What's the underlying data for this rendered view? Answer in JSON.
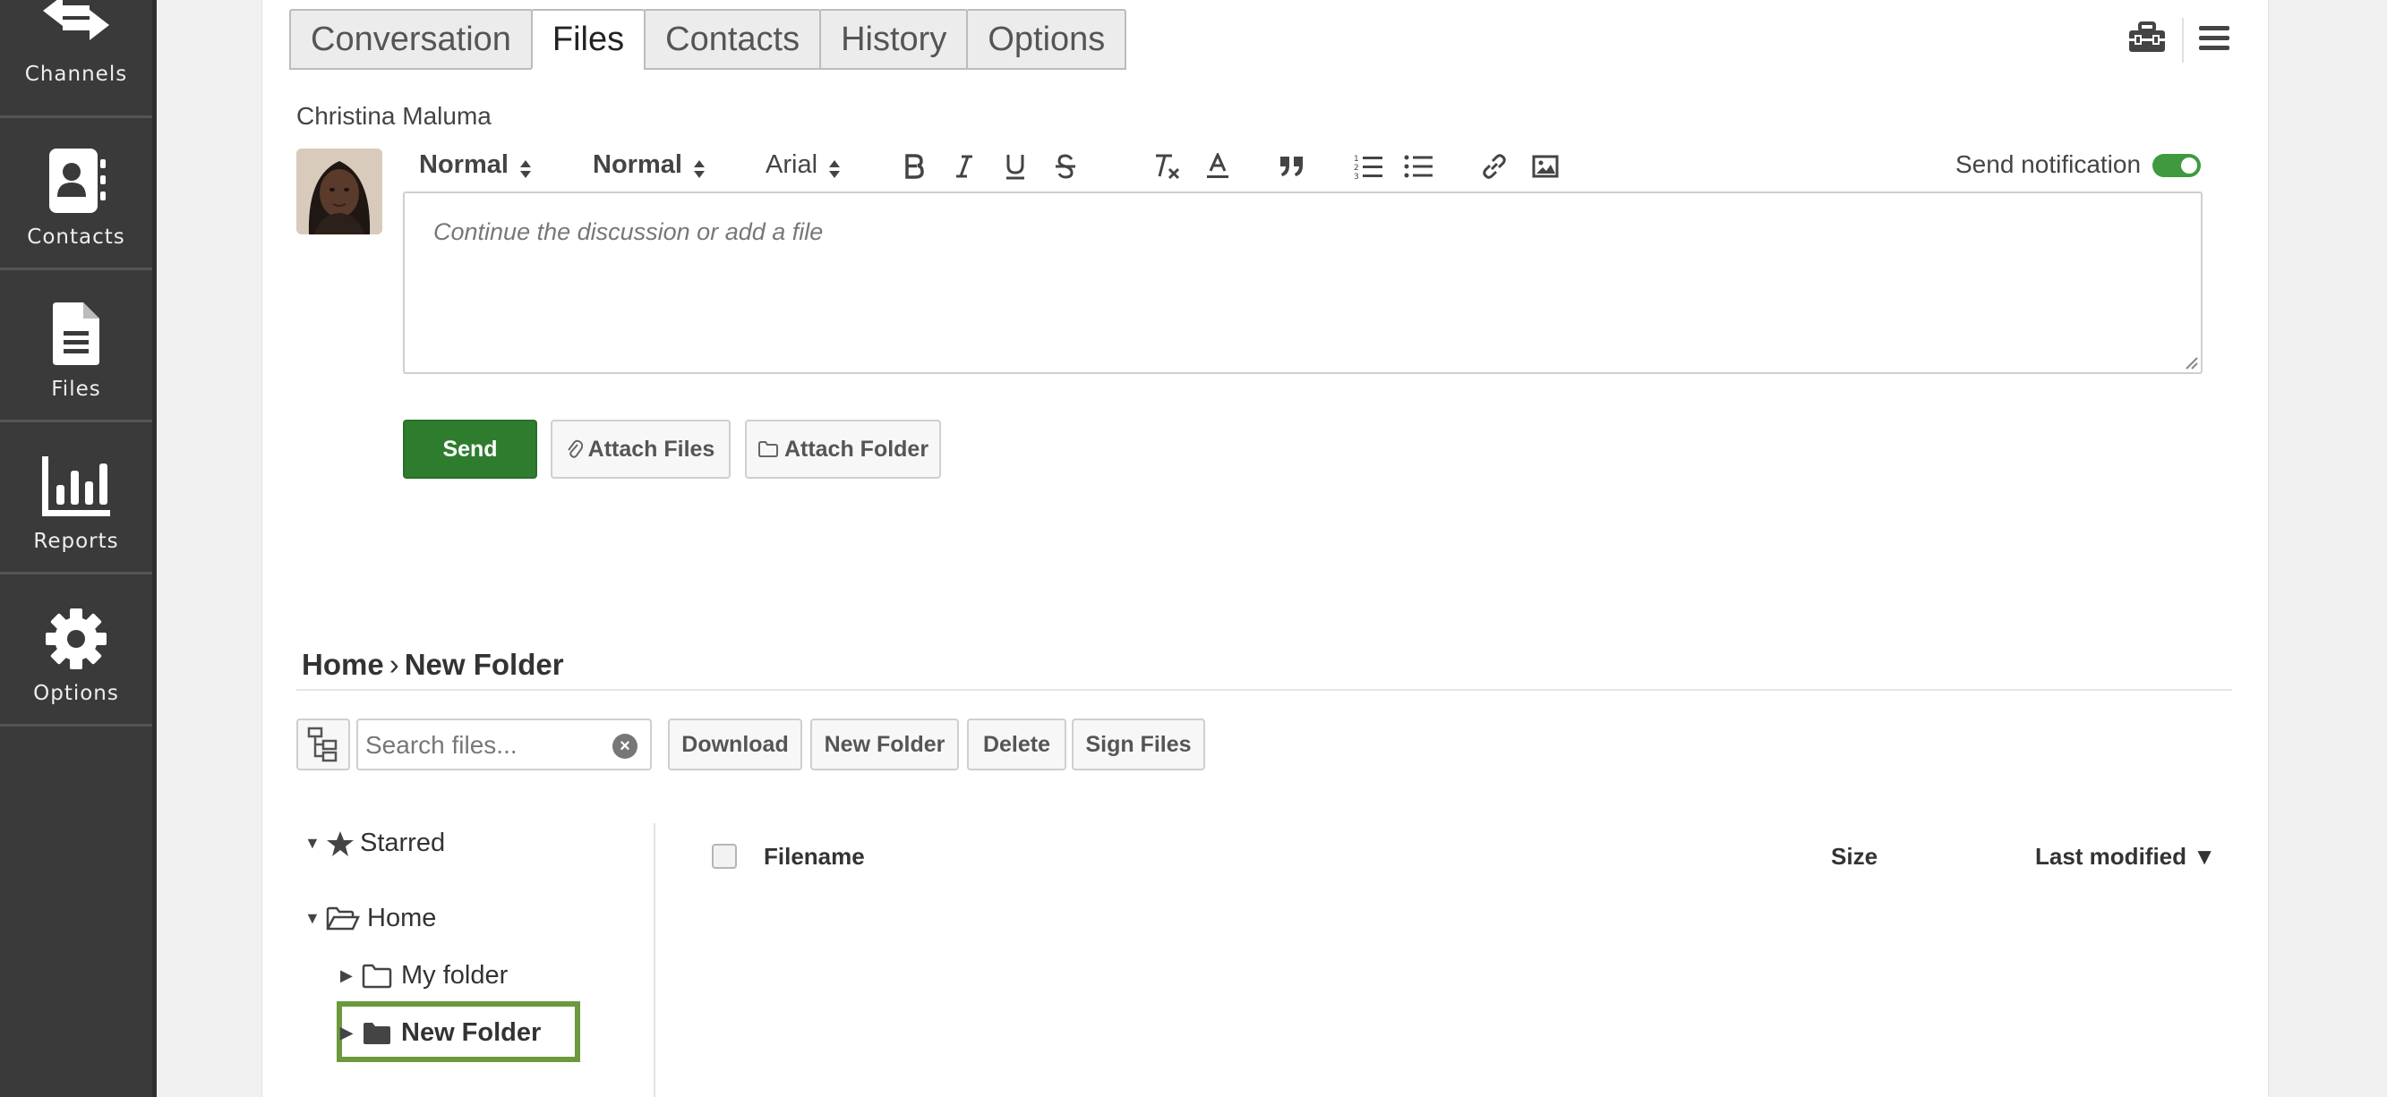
{
  "sidebar": {
    "items": [
      {
        "label": "Channels",
        "icon": "channels-arrows-icon"
      },
      {
        "label": "Contacts",
        "icon": "contacts-book-icon"
      },
      {
        "label": "Files",
        "icon": "file-icon"
      },
      {
        "label": "Reports",
        "icon": "bar-chart-icon"
      },
      {
        "label": "Options",
        "icon": "gear-icon"
      }
    ]
  },
  "tabs": [
    {
      "label": "Conversation",
      "active": false
    },
    {
      "label": "Files",
      "active": true
    },
    {
      "label": "Contacts",
      "active": false
    },
    {
      "label": "History",
      "active": false
    },
    {
      "label": "Options",
      "active": false
    }
  ],
  "header_icons": [
    "toolbox-icon",
    "hamburger-menu-icon"
  ],
  "composer": {
    "author": "Christina Maluma",
    "toolbar": {
      "heading_select": "Normal",
      "size_select": "Normal",
      "font_select": "Arial",
      "buttons": [
        "bold-icon",
        "italic-icon",
        "underline-icon",
        "strikethrough-icon",
        "clear-format-icon",
        "text-color-icon",
        "blockquote-icon",
        "ordered-list-icon",
        "bullet-list-icon",
        "link-icon",
        "image-icon"
      ]
    },
    "notification": {
      "label": "Send notification",
      "enabled": true
    },
    "placeholder": "Continue the discussion or add a file",
    "send_label": "Send",
    "attach_files_label": "Attach Files",
    "attach_folder_label": "Attach Folder"
  },
  "files": {
    "breadcrumb": {
      "root": "Home",
      "separator": "›",
      "current": "New Folder"
    },
    "search_placeholder": "Search files...",
    "buttons": {
      "download": "Download",
      "new_folder": "New Folder",
      "delete": "Delete",
      "sign_files": "Sign Files"
    },
    "tree": {
      "starred": "Starred",
      "home": "Home",
      "children": [
        "My folder",
        "New Folder"
      ],
      "selected": "New Folder"
    },
    "table": {
      "headers": {
        "filename": "Filename",
        "size": "Size",
        "last_modified": "Last modified ▼"
      }
    }
  },
  "colors": {
    "accent_green": "#2e7d2e",
    "sidebar_bg": "#3a3a3a",
    "selection_outline": "#6b9a3c"
  }
}
